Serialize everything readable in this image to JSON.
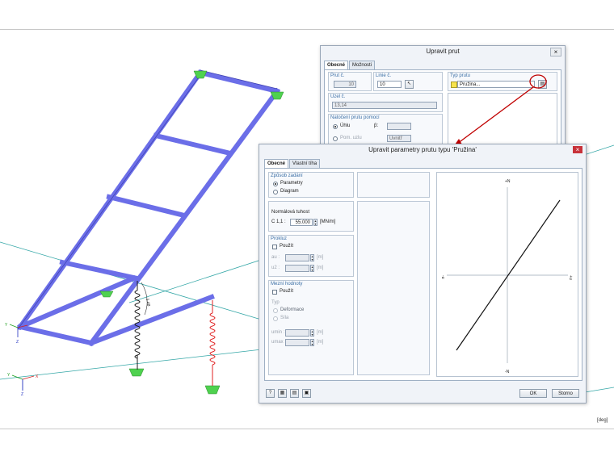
{
  "colors": {
    "member": "#6b6ee8",
    "support": "#4fd14f",
    "spring_black": "#1a1a1a",
    "spring_red": "#e02020",
    "axis_line": "#34a7a7",
    "accent_red": "#c00000"
  },
  "viewport": {
    "units_label": "[deg]",
    "axis_label_y": "Y",
    "axis_label_z": "Z",
    "axis_label_x": "X",
    "dimension_label": "1.48"
  },
  "dialog_member": {
    "title": "Upravit prut",
    "close": "×",
    "tabs": [
      "Obecné",
      "Možnosti"
    ],
    "member_no_label": "Prut č.",
    "member_no_value": "10",
    "line_no_label": "Linie č.",
    "line_no_value": "10",
    "member_type_label": "Typ prutu",
    "member_type_value": "Pružina...",
    "nodes_label": "Uzel č.",
    "nodes_value": "13,14",
    "rotation_label": "Natočení prutu pomocí",
    "rotation_angle_label": "Úhlu",
    "rotation_help_label": "Pom. uzlu",
    "beta_label": "β:",
    "plane_label": "Uvnitř"
  },
  "dialog_spring": {
    "title": "Upravit parametry prutu typu 'Pružina'",
    "close": "×",
    "tabs": [
      "Obecné",
      "Vlastní tíha"
    ],
    "input_method_label": "Způsob zadání",
    "option_parameters": "Parametry",
    "option_diagram": "Diagram",
    "stiffness_label": "Normálová tuhost",
    "stiffness_symbol": "C 1,1 :",
    "stiffness_value": "55.000",
    "stiffness_unit": "[MN/m]",
    "slack_label": "Prokluz",
    "slack_use": "Použít",
    "slack_u1": "au :",
    "slack_u2": "u2 :",
    "slack_unit": "[m]",
    "limit_label": "Mezní hodnoty",
    "limit_use": "Použít",
    "limit_type_label": "Typ",
    "limit_deformation": "Deformace",
    "limit_force": "Síla",
    "limit_umin": "umin :",
    "limit_umax": "umax :",
    "limit_unit": "[m]",
    "diagram_top": "+N",
    "diagram_bottom": "-N",
    "diagram_left": "-u",
    "diagram_right": "+u",
    "ok": "OK",
    "cancel": "Storno"
  }
}
